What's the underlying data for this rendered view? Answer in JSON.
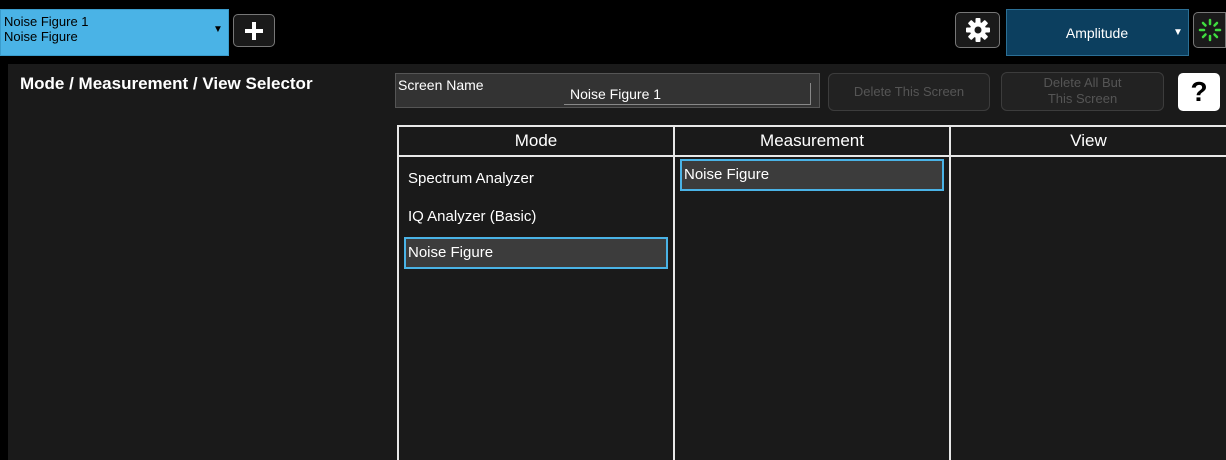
{
  "topbar": {
    "screen_tab": {
      "line1": "Noise Figure 1",
      "line2": "Noise Figure",
      "arrow": "▼"
    },
    "add_icon": "plus-icon",
    "settings_icon": "gear-icon",
    "amplitude_button": {
      "label": "Amplitude",
      "arrow": "▼"
    },
    "busy_icon": "spinner-icon"
  },
  "panel": {
    "title": "Mode / Measurement / View Selector",
    "screen_name_label": "Screen Name",
    "screen_name_value": "Noise Figure 1",
    "delete_this_label": "Delete This Screen",
    "delete_all_line1": "Delete All But",
    "delete_all_line2": "This Screen",
    "help_label": "?"
  },
  "columns": {
    "mode": {
      "header": "Mode",
      "items": [
        "Spectrum Analyzer",
        "IQ Analyzer (Basic)",
        "Noise Figure"
      ],
      "selected": "Noise Figure"
    },
    "measurement": {
      "header": "Measurement",
      "items": [
        "Noise Figure"
      ],
      "selected": "Noise Figure"
    },
    "view": {
      "header": "View",
      "items": []
    }
  },
  "colors": {
    "accent": "#4ab3e6",
    "amplitude_bg": "#0c3f5f",
    "panel_bg": "#1a1a1a",
    "spinner": "#3fdc3f"
  }
}
